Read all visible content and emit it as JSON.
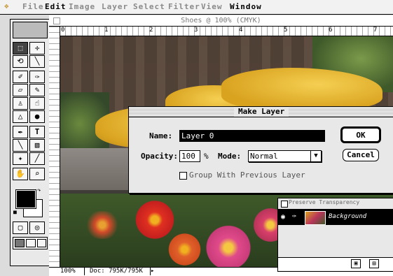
{
  "menubar": {
    "apple_icon": "apple-icon",
    "items": [
      "File",
      "Edit",
      "Image",
      "Layer",
      "Select",
      "Filter",
      "View",
      "Window"
    ],
    "active": [
      "Edit",
      "Window"
    ]
  },
  "document": {
    "title": "Shoes @ 100% (CMYK)",
    "ruler_ticks": [
      "0",
      "1",
      "2",
      "3",
      "4",
      "5",
      "6",
      "7"
    ],
    "status": {
      "zoom": "100%",
      "doc_size": "Doc: 795K/795K"
    }
  },
  "dialog": {
    "title": "Make Layer",
    "name_label": "Name:",
    "name_value": "Layer 0",
    "opacity_label": "Opacity:",
    "opacity_value": "100",
    "percent_sign": "%",
    "mode_label": "Mode:",
    "mode_value": "Normal",
    "group_label": "Group With Previous Layer",
    "group_checked": false,
    "ok_label": "OK",
    "cancel_label": "Cancel"
  },
  "layers_palette": {
    "preserve_label": "Preserve Transparency",
    "layer_name": "Background"
  }
}
